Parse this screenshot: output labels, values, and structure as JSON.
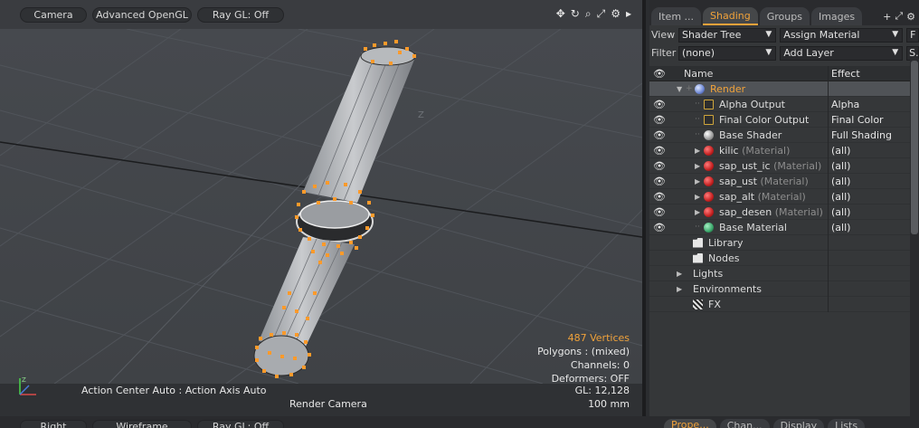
{
  "viewport": {
    "toolbar": {
      "camera": "Camera",
      "render_mode": "Advanced OpenGL",
      "ray_gl": "Ray GL: Off"
    },
    "stats": {
      "vertices": "487 Vertices",
      "polygons": "Polygons : (mixed)",
      "channels": "Channels: 0",
      "deformers": "Deformers: OFF",
      "gl": "GL: 12,128",
      "scale": "100 mm"
    },
    "action_center": "Action Center Auto : Action Axis Auto",
    "camera_name": "Render Camera",
    "axis_label": "Z"
  },
  "bottom_viewport": {
    "view": "Right",
    "render_mode": "Wireframe",
    "ray_gl": "Ray GL: Off"
  },
  "panel": {
    "tabs": [
      "Item ...",
      "Shading",
      "Groups",
      "Images"
    ],
    "active_tab": "Shading",
    "view_label": "View",
    "view_value": "Shader Tree",
    "assign_material": "Assign Material",
    "f_button": "F",
    "filter_label": "Filter",
    "filter_value": "(none)",
    "add_layer": "Add Layer",
    "s_button": "S...",
    "columns": {
      "name": "Name",
      "effect": "Effect"
    },
    "tree": [
      {
        "name": "Render",
        "effect": ""
      },
      {
        "name": "Alpha Output",
        "effect": "Alpha"
      },
      {
        "name": "Final Color Output",
        "effect": "Final Color"
      },
      {
        "name": "Base Shader",
        "effect": "Full Shading"
      },
      {
        "name": "kilic",
        "type": "(Material)",
        "effect": "(all)"
      },
      {
        "name": "sap_ust_ic",
        "type": "(Material)",
        "effect": "(all)"
      },
      {
        "name": "sap_ust",
        "type": "(Material)",
        "effect": "(all)"
      },
      {
        "name": "sap_alt",
        "type": "(Material)",
        "effect": "(all)"
      },
      {
        "name": "sap_desen",
        "type": "(Material)",
        "effect": "(all)"
      },
      {
        "name": "Base Material",
        "effect": "(all)"
      },
      {
        "name": "Library",
        "effect": ""
      },
      {
        "name": "Nodes",
        "effect": ""
      },
      {
        "name": "Lights",
        "effect": ""
      },
      {
        "name": "Environments",
        "effect": ""
      },
      {
        "name": "FX",
        "effect": ""
      }
    ]
  },
  "bottom_panel_tabs": [
    "Prope...",
    "Chan...",
    "Display",
    "Lists"
  ],
  "colors": {
    "accent": "#f0a23a",
    "selection_orange": "#ff9a2a"
  }
}
